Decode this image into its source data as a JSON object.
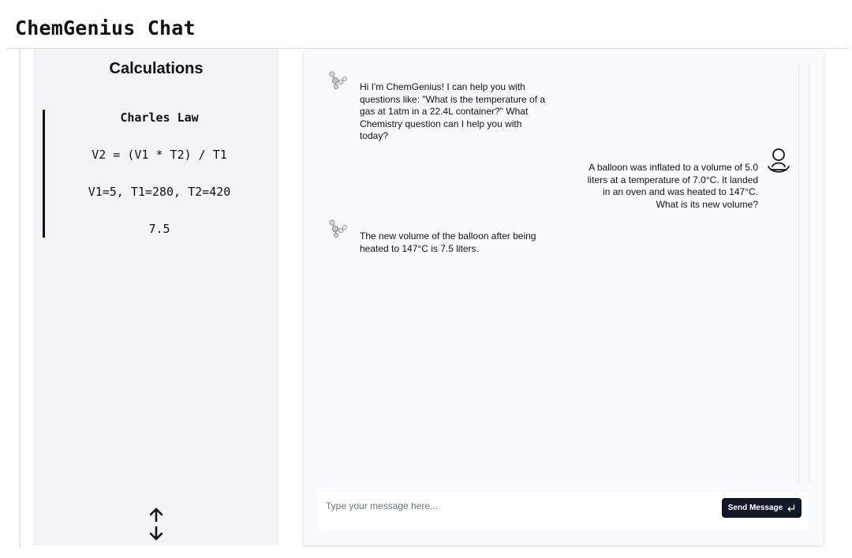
{
  "app": {
    "title": "ChemGenius Chat"
  },
  "calculations": {
    "title": "Calculations",
    "law_name": "Charles Law",
    "formula": "V2 = (V1 * T2) / T1",
    "variables": "V1=5, T1=280, T2=420",
    "result": "7.5"
  },
  "chat": {
    "messages": [
      {
        "role": "bot",
        "text": "Hi I'm ChemGenius! I can help you with questions like: \"What is the temperature of a gas at 1atm in a 22.4L container?\" What Chemistry question can I help you with today?"
      },
      {
        "role": "user",
        "text": "A balloon was inflated to a volume of 5.0 liters at a temperature of 7.0°C. It landed in an oven and was heated to 147°C. What is its new volume?"
      },
      {
        "role": "bot",
        "text": "The new volume of the balloon after being heated to 147°C is 7.5 liters."
      }
    ],
    "input": {
      "value": "",
      "placeholder": "Type your message here..."
    },
    "send_label": "Send Message"
  },
  "icons": {
    "bot_avatar": "molecule-icon",
    "user_avatar": "user-icon",
    "send": "return-arrow-icon",
    "scroll": "up-down-arrows-icon"
  },
  "colors": {
    "send_button": "#111827",
    "calc_panel_bg": "#f3f4f6",
    "chat_panel_bg": "#f9fafb"
  }
}
